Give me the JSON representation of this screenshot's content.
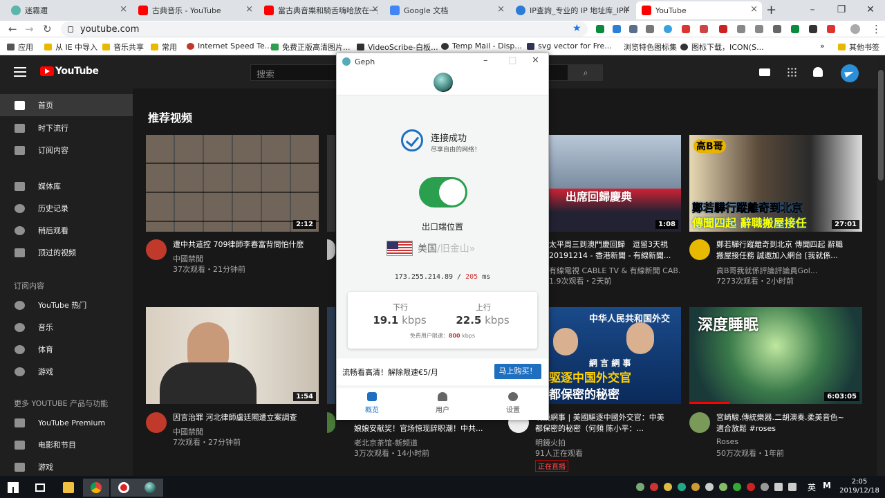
{
  "browser": {
    "tabs": [
      {
        "title": "迷霧邇",
        "color": "#5ab5aa"
      },
      {
        "title": "古典音乐 - YouTube",
        "color": "#ff0000"
      },
      {
        "title": "當古典音樂和騎舌嗨哈放在一起",
        "color": "#ff0000"
      },
      {
        "title": "Google 文档",
        "color": "#4285f4"
      },
      {
        "title": "IP查詢_专业的 IP 地址库_IPIP",
        "color": "#2e7bd6"
      },
      {
        "title": "YouTube",
        "color": "#ff0000"
      }
    ],
    "url": "youtube.com",
    "bookmarks": [
      "应用",
      "从 IE 中导入",
      "音乐共享",
      "常用",
      "Internet Speed Te...",
      "免费正版高清图片...",
      "VideoScribe-白板...",
      "Temp Mail - Disp...",
      "svg vector for Fre...",
      "浏览特色图标集",
      "图标下载，ICON(S...",
      "»",
      "其他书签"
    ]
  },
  "youtube": {
    "logo_text": "YouTube",
    "search_placeholder": "搜索",
    "sidebar": {
      "main": [
        "首页",
        "时下流行",
        "订阅内容"
      ],
      "library": [
        "媒体库",
        "历史记录",
        "稍后观看",
        "顶过的视频"
      ],
      "subs_header": "订阅内容",
      "subs": [
        "YouTube 热门",
        "音乐",
        "体育",
        "游戏"
      ],
      "more_header": "更多 YOUTUBE 产品与功能",
      "more": [
        "YouTube Premium",
        "电影和节目",
        "游戏"
      ]
    },
    "section_title": "推荐视频",
    "videos": [
      {
        "title": "遭中共遣控 709律師李春富背問怕什麼",
        "title2": "",
        "channel": "中國禁聞",
        "meta": "37次观看・21分钟前",
        "duration": "2:12"
      },
      {
        "title": "太平周三到澳門慶回歸　逗留3天視",
        "title2": "20191214 - 香港新聞 - 有線新聞...",
        "channel": "有線電視 CABLE TV & 有線新聞 CAB...",
        "meta": "1.9次观看・2天前",
        "duration": "1:08"
      },
      {
        "title": "鄭若驊行蹤離奇到北京 傳聞四起 辭職",
        "title2": "搬屋接任務 誠邀加入網台 [我就係...",
        "channel": "高B哥我就係評論評論員Gol...",
        "meta": "7273次观看・2小时前",
        "duration": "27:01"
      },
      {
        "title": "因言治罪 河北律師盧廷閣遭立案調查",
        "title2": "",
        "channel": "中國禁聞",
        "meta": "7次观看・27分钟前",
        "duration": "1:54"
      },
      {
        "title": "娘娘安献奖！官场惊现辞职潮！中共...",
        "title2": "",
        "channel": "老北京茶馆-新频道",
        "meta": "3万次观看・14小时前",
        "duration": ""
      },
      {
        "title": "明鏡網事 | 美國驅逐中國外交官：中美",
        "title2": "都保密的秘密（何頻 陈小平：...",
        "channel": "明鏡火拍",
        "meta": "91人正在观看",
        "duration": "",
        "badge": "正在直播"
      },
      {
        "title": "宮崎駿.傳統樂器.二胡演奏.柔美音色~",
        "title2": "適合放鬆 #roses",
        "channel": "Roses",
        "meta": "50万次观看・1年前",
        "duration": "6:03:05"
      }
    ],
    "thumb_texts": {
      "t3": "出席回歸慶典",
      "t4a": "高B哥",
      "t4b": "鄭若驊行蹤離奇到北京",
      "t4c": "傳聞四起 辭職搬屋接任",
      "t7a": "中华人民共和国外交",
      "t7b": "網 言 網 事",
      "t7c": "驱逐中国外交官",
      "t7d": "都保密的秘密",
      "t8": "深度睡眠"
    }
  },
  "geph": {
    "window_title": "Geph",
    "status_title": "连接成功",
    "status_sub": "尽享自由的网络！",
    "exit_label": "出口端位置",
    "location_country": "美国",
    "location_city": "/旧金山»",
    "ip": "173.255.214.89 / ",
    "ping": "205",
    "ping_unit": " ms",
    "down_label": "下行",
    "down_value": "19.1",
    "up_label": "上行",
    "up_value": "22.5",
    "speed_unit": "kbps",
    "limit_text": "免费用户限速：",
    "limit_value": "800",
    "limit_unit": " kbps",
    "promo_text": "流畅看高清！解除限速€5/月",
    "buy_button": "马上购买！",
    "nav": [
      "概览",
      "用户",
      "设置"
    ]
  },
  "taskbar": {
    "ime": "英",
    "time": "2:05",
    "date": "2019/12/18"
  }
}
